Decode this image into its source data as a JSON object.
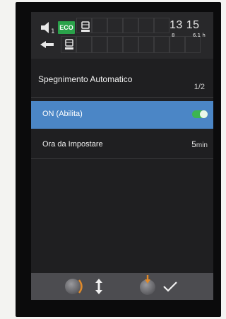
{
  "status": {
    "speed_number": "1",
    "eco_label": "ECO",
    "time": "13 15",
    "date_digit": "8",
    "hours": "6.1 h",
    "icons": [
      "speaker-icon",
      "engine-oil-icon",
      "fuel-icon",
      "parking-brake-icon"
    ]
  },
  "menu": {
    "title": "Spegnimento Automatico",
    "page": "1/2",
    "items": [
      {
        "label": "ON (Abilita)",
        "toggle_on": true
      },
      {
        "label": "Ora da Impostare",
        "value": "5",
        "unit": "min"
      }
    ]
  },
  "bottom": {
    "icons": [
      "rotary-knob-icon",
      "scroll-updown-icon",
      "rotary-push-icon",
      "confirm-check-icon"
    ]
  },
  "colors": {
    "selected_row": "#4b86c6",
    "eco": "#2aa24a",
    "toggle": "#3cb551",
    "accent_orange": "#e08a2a"
  }
}
